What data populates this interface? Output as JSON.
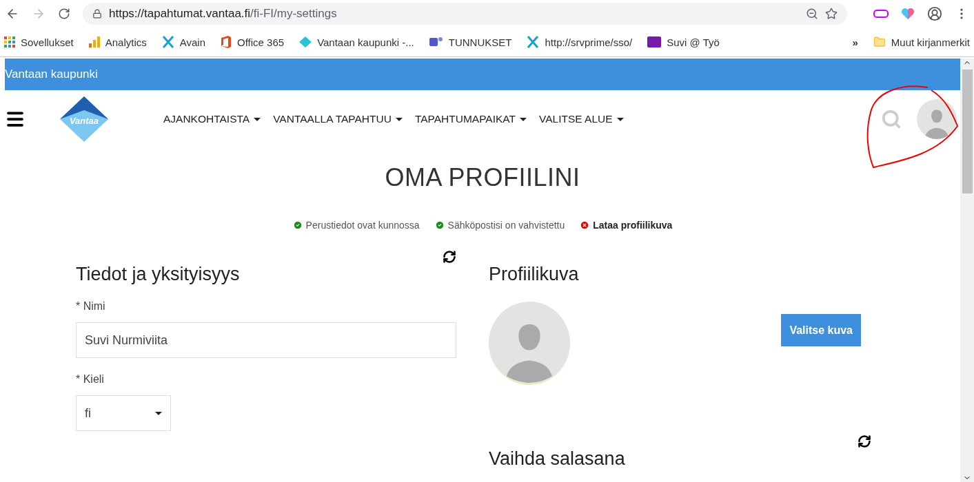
{
  "browser": {
    "url_host": "https://tapahtumat.vantaa.fi",
    "url_path": "/fi-FI/my-settings"
  },
  "bookmarks": [
    {
      "label": "Sovellukset",
      "kind": "apps"
    },
    {
      "label": "Analytics",
      "kind": "bars"
    },
    {
      "label": "Avain",
      "kind": "x"
    },
    {
      "label": "Office 365",
      "kind": "office"
    },
    {
      "label": "Vantaan kaupunki -...",
      "kind": "diamond"
    },
    {
      "label": "TUNNUKSET",
      "kind": "teams"
    },
    {
      "label": "http://srvprime/sso/",
      "kind": "x"
    },
    {
      "label": "Suvi @ Työ",
      "kind": "onenote"
    }
  ],
  "bookmarks_more": "»",
  "other_bookmarks": "Muut kirjanmerkit",
  "top_bar": "Vantaan kaupunki",
  "logo_text": "Vantaa",
  "nav": [
    "AJANKOHTAISTA",
    "VANTAALLA TAPAHTUU",
    "TAPAHTUMAPAIKAT",
    "VALITSE ALUE"
  ],
  "title": "OMA PROFIILINI",
  "status": [
    {
      "label": "Perustiedot ovat kunnossa",
      "done": true
    },
    {
      "label": "Sähköpostisi on vahvistettu",
      "done": true
    },
    {
      "label": "Lataa profiilikuva",
      "done": false
    }
  ],
  "info": {
    "heading": "Tiedot ja yksityisyys",
    "name_label": "* Nimi",
    "name_value": "Suvi Nurmiviita",
    "lang_label": "* Kieli",
    "lang_value": "fi"
  },
  "photo": {
    "heading": "Profiilikuva",
    "button": "Valitse kuva"
  },
  "password": {
    "heading": "Vaihda salasana"
  }
}
